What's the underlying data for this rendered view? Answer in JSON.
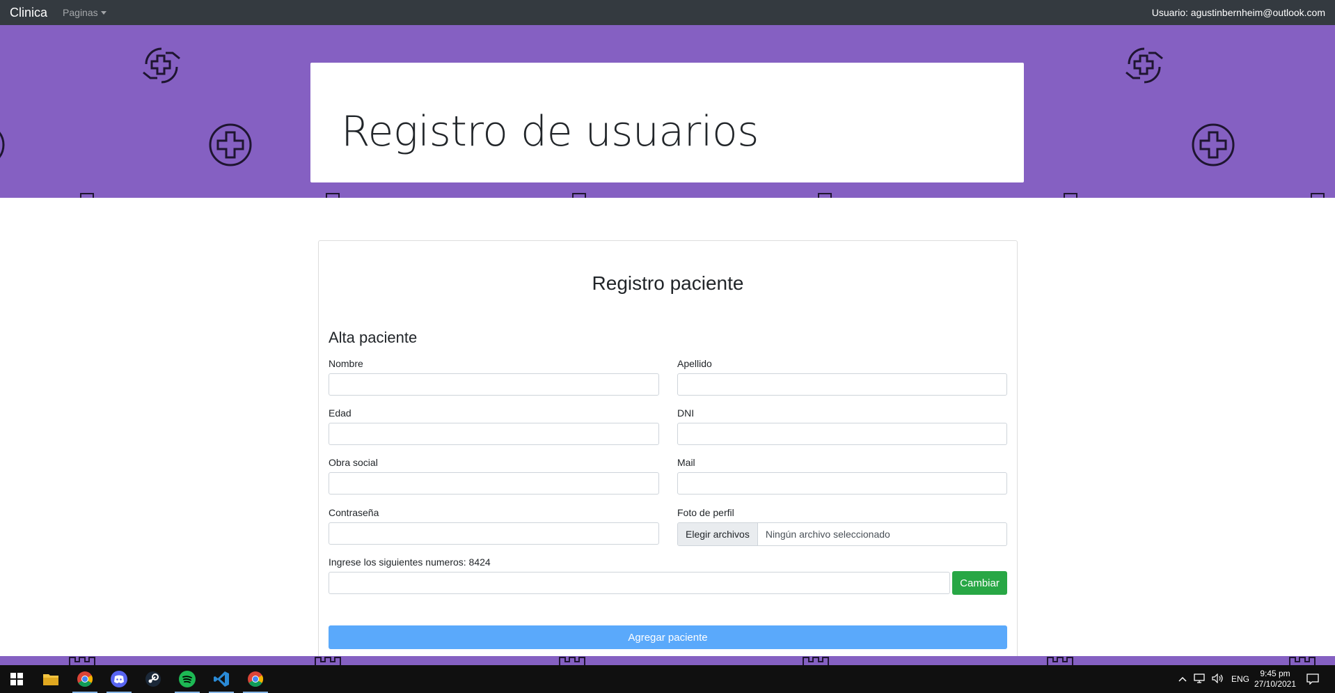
{
  "navbar": {
    "brand": "Clinica",
    "pages_label": "Paginas",
    "user_text": "Usuario: agustinbernheim@outlook.com"
  },
  "banner": {
    "title": "Registro de usuarios"
  },
  "form": {
    "title": "Registro paciente",
    "section_title": "Alta paciente",
    "fields": {
      "nombre": {
        "label": "Nombre",
        "value": ""
      },
      "apellido": {
        "label": "Apellido",
        "value": ""
      },
      "edad": {
        "label": "Edad",
        "value": ""
      },
      "dni": {
        "label": "DNI",
        "value": ""
      },
      "obra_social": {
        "label": "Obra social",
        "value": ""
      },
      "mail": {
        "label": "Mail",
        "value": ""
      },
      "contrasena": {
        "label": "Contraseña",
        "value": ""
      },
      "foto": {
        "label": "Foto de perfil",
        "button": "Elegir archivos",
        "status": "Ningún archivo seleccionado"
      },
      "captcha": {
        "label": "Ingrese los siguientes numeros: 8424",
        "value": ""
      }
    },
    "change_button": "Cambiar",
    "submit_button": "Agregar paciente"
  },
  "taskbar": {
    "apps": [
      "windows-start",
      "file-explorer",
      "chrome",
      "discord",
      "steam",
      "spotify",
      "vscode",
      "chrome"
    ],
    "language": "ENG",
    "time": "9:45 pm",
    "date": "27/10/2021"
  },
  "colors": {
    "banner": "#8560c2",
    "navbar": "#343a40",
    "green_button": "#28a745",
    "blue_button": "#5aa9fb",
    "taskbar": "#101010"
  }
}
